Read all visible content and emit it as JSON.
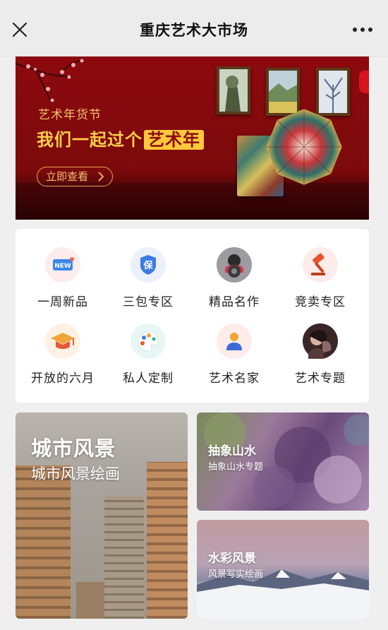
{
  "navbar": {
    "title": "重庆艺术大市场",
    "close_icon": "close-icon",
    "more_icon": "more-dots-icon"
  },
  "banner": {
    "subtitle": "艺术年货节",
    "headline_prefix": "我们一起过个",
    "headline_highlight": "艺术年",
    "cta_label": "立即查看",
    "colors": {
      "background": "#8d0a0e",
      "gold": "#ffd04a",
      "highlight": "#ffc93a"
    }
  },
  "categories": [
    {
      "label": "一周新品",
      "icon": "new-badge-icon"
    },
    {
      "label": "三包专区",
      "icon": "guarantee-shield-icon"
    },
    {
      "label": "精品名作",
      "icon": "masterpiece-thumb-icon"
    },
    {
      "label": "竞卖专区",
      "icon": "auction-gavel-icon"
    },
    {
      "label": "开放的六月",
      "icon": "graduation-cap-icon"
    },
    {
      "label": "私人定制",
      "icon": "palette-icon"
    },
    {
      "label": "艺术名家",
      "icon": "artist-person-icon"
    },
    {
      "label": "艺术专题",
      "icon": "topic-portrait-icon"
    }
  ],
  "tiles": [
    {
      "title": "城市风景",
      "subtitle": "城市风景绘画"
    },
    {
      "title": "抽象山水",
      "subtitle": "抽象山水专题"
    },
    {
      "title": "水彩风景",
      "subtitle": "风景写实绘画"
    }
  ]
}
